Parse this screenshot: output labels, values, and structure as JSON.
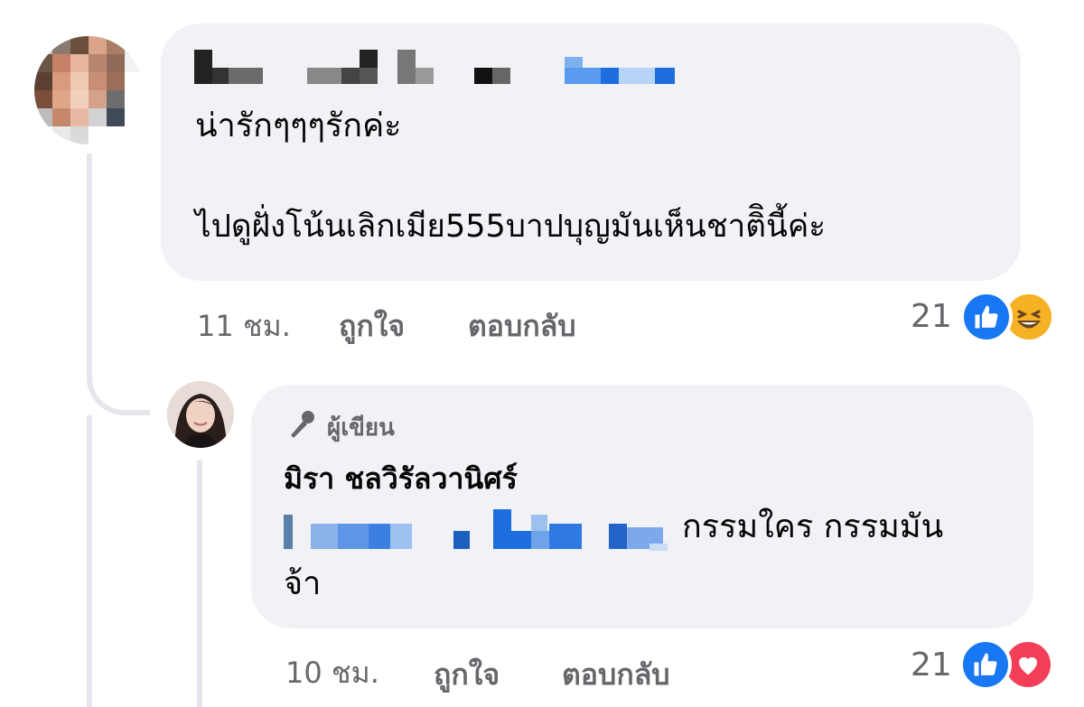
{
  "comments": [
    {
      "author_name": "",
      "text_line1": "น่ารักๆๆๆรักค่ะ",
      "text_line2": "ไปดูฝั่งโน้นเลิกเมีย555บาปบุญมันเห็นชาติินี้ค่ะ",
      "time": "11 ชม.",
      "like_label": "ถูกใจ",
      "reply_label": "ตอบกลับ",
      "reaction_count": "21",
      "reactions": [
        "like-icon",
        "haha-icon"
      ]
    },
    {
      "badge_label": "ผู้เขียน",
      "author_name": "มิรา ชลวิรัลวานิศร์",
      "text_after_mention": "กรรมใคร กรรมมัน",
      "text_line2": "จ้า",
      "time": "10 ชม.",
      "like_label": "ถูกใจ",
      "reply_label": "ตอบกลับ",
      "reaction_count": "21",
      "reactions": [
        "like-icon",
        "love-icon"
      ]
    }
  ],
  "colors": {
    "bubble": "#f0f2f5",
    "meta_text": "#65676b",
    "like_blue": "#1877f2",
    "love_red": "#f33e58",
    "haha_yellow": "#f7b125"
  }
}
